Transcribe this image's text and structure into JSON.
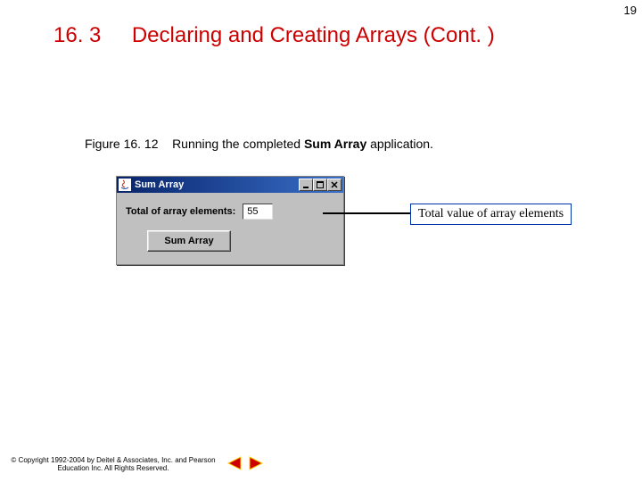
{
  "page_number": "19",
  "heading": {
    "section_number": "16. 3",
    "title": "Declaring and Creating Arrays (Cont. )"
  },
  "figure_caption": {
    "label": "Figure 16. 12",
    "text_before": "Running the completed ",
    "bold": "Sum Array",
    "text_after": " application."
  },
  "window": {
    "title": "Sum Array",
    "body": {
      "label": "Total of array elements:",
      "value": "55",
      "button": "Sum Array"
    }
  },
  "callout": "Total value of array elements",
  "copyright": "© Copyright 1992-2004 by Deitel & Associates, Inc. and Pearson Education Inc. All Rights Reserved."
}
